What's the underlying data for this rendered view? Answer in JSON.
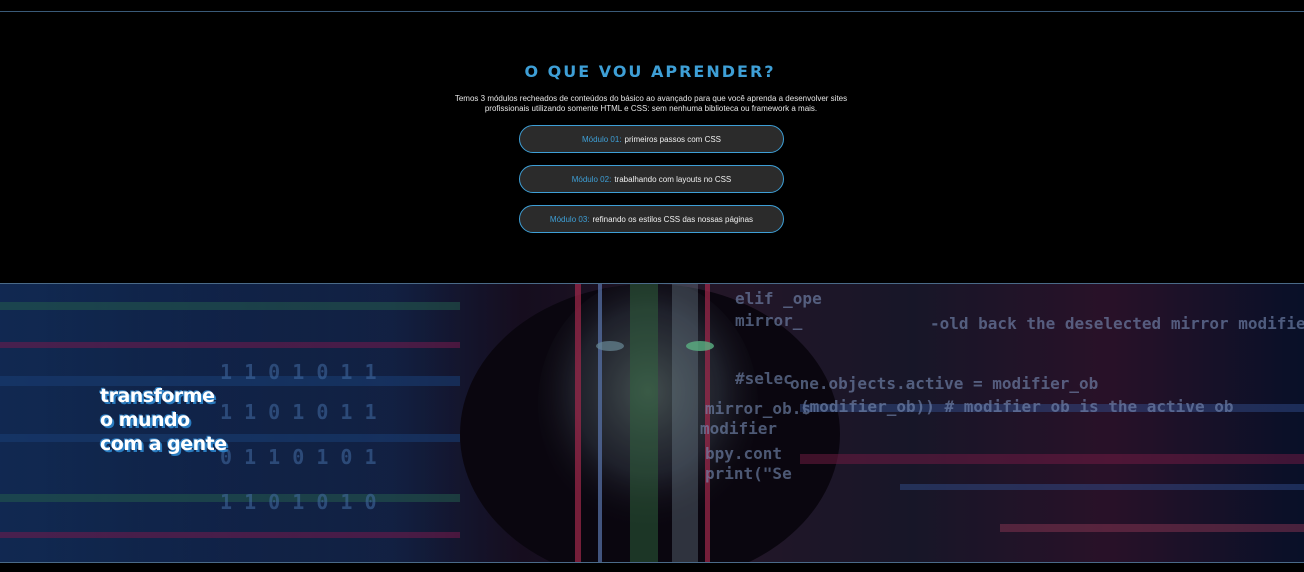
{
  "modules_section": {
    "title": "O QUE VOU APRENDER?",
    "description": "Temos 3 módulos recheados de conteúdos do básico ao avançado para que você aprenda a desenvolver sites profissionais utilizando somente HTML e CSS: sem nenhuma biblioteca ou framework a mais.",
    "modules": [
      {
        "number": "Módulo 01:",
        "text": "primeiros passos com CSS"
      },
      {
        "number": "Módulo 02:",
        "text": "trabalhando com layouts no CSS"
      },
      {
        "number": "Módulo 03:",
        "text": "refinando os estilos CSS das nossas páginas"
      }
    ]
  },
  "hero": {
    "tagline_line1": "transforme",
    "tagline_line2": "o mundo",
    "tagline_line3": "com a gente",
    "accent_color": "#3e9fd6"
  }
}
